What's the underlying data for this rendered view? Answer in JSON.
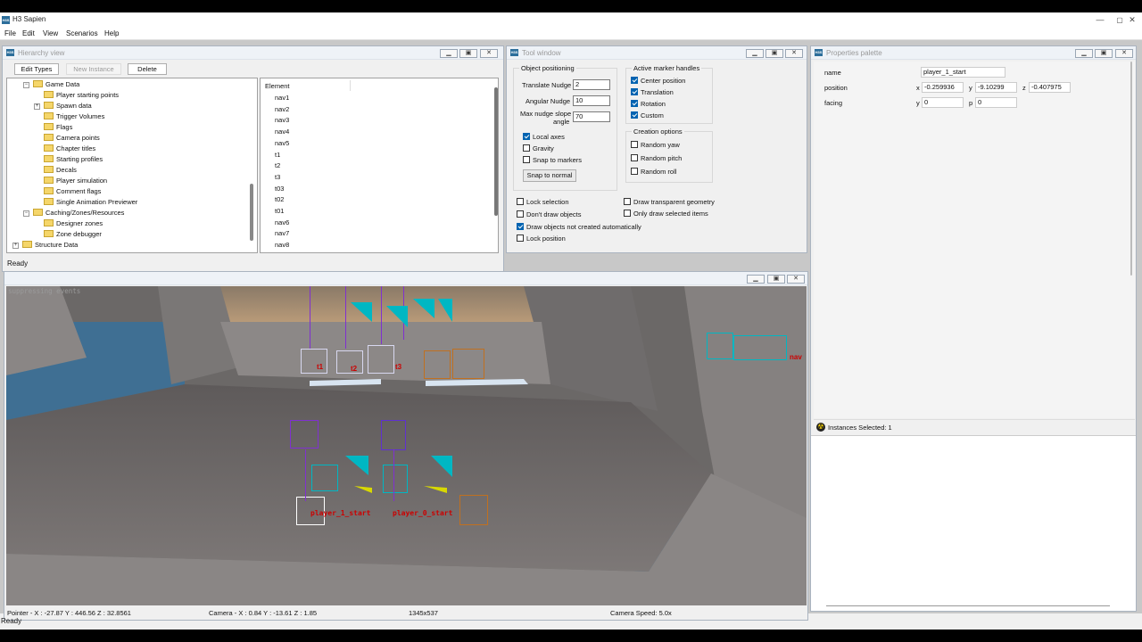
{
  "app": {
    "title": "H3 Sapien",
    "icon_text": "H3S",
    "window_controls": [
      "—",
      "▢",
      "✕"
    ],
    "menu": [
      "File",
      "Edit",
      "View",
      "Scenarios",
      "Help"
    ],
    "status": "Ready"
  },
  "hierarchy": {
    "title": "Hierarchy view",
    "toolbar": {
      "edit_types": "Edit Types",
      "new_instance": "New Instance",
      "delete": "Delete"
    },
    "tree": [
      {
        "label": "Game Data",
        "expander": "−"
      },
      {
        "label": "Player starting points"
      },
      {
        "label": "Spawn data",
        "expander": "+"
      },
      {
        "label": "Trigger Volumes"
      },
      {
        "label": "Flags"
      },
      {
        "label": "Camera points"
      },
      {
        "label": "Chapter titles"
      },
      {
        "label": "Starting profiles"
      },
      {
        "label": "Decals"
      },
      {
        "label": "Player simulation"
      },
      {
        "label": "Comment flags"
      },
      {
        "label": "Single Animation Previewer"
      },
      {
        "label": "Caching/Zones/Resources",
        "expander": "−"
      },
      {
        "label": "Designer zones"
      },
      {
        "label": "Zone debugger"
      },
      {
        "label": "Structure Data",
        "expander": "+"
      }
    ],
    "list_header": "Element",
    "list": [
      "nav1",
      "nav2",
      "nav3",
      "nav4",
      "nav5",
      "t1",
      "t2",
      "t3",
      "t03",
      "t02",
      "t01",
      "nav6",
      "nav7",
      "nav8"
    ],
    "status": "Ready"
  },
  "tool": {
    "title": "Tool window",
    "object_positioning": {
      "label": "Object positioning",
      "translate_nudge_label": "Translate Nudge",
      "translate_nudge": "2",
      "angular_nudge_label": "Angular Nudge",
      "angular_nudge": "10",
      "max_nudge_label_1": "Max nudge slope",
      "max_nudge_label_2": "angle",
      "max_nudge": "70",
      "local_axes": "Local axes",
      "gravity": "Gravity",
      "snap_to_markers": "Snap to markers",
      "snap_to_normal": "Snap to normal"
    },
    "marker_handles": {
      "label": "Active marker handles",
      "center_position": "Center position",
      "translation": "Translation",
      "rotation": "Rotation",
      "custom": "Custom"
    },
    "creation": {
      "label": "Creation options",
      "random_yaw": "Random yaw",
      "random_pitch": "Random pitch",
      "random_roll": "Random roll"
    },
    "lock_selection": "Lock selection",
    "dont_draw": "Don't draw objects",
    "draw_not_created": "Draw objects not created automatically",
    "lock_position": "Lock position",
    "draw_transparent": "Draw transparent geometry",
    "only_draw_selected": "Only draw selected items"
  },
  "properties": {
    "title": "Properties palette",
    "name_label": "name",
    "name_value": "player_1_start",
    "position_label": "position",
    "x_label": "x",
    "x_value": "-0.259936",
    "y_label": "y",
    "y_value": "-9.10299",
    "z_label": "z",
    "z_value": "-0.407975",
    "facing_label": "facing",
    "facing_y_label": "y",
    "facing_y": "0",
    "facing_p_label": "p",
    "facing_p": "0",
    "instances_selected": "Instances Selected: 1"
  },
  "viewport": {
    "overlay_text": "suppressing events",
    "labels": {
      "t1": "t1",
      "t2": "t2",
      "t3": "t3",
      "nav": "nav",
      "p1": "player_1_start",
      "p0": "player_0_start"
    },
    "status": {
      "pointer": "Pointer - X : -27.87  Y : 446.56  Z : 32.8561",
      "camera": "Camera - X : 0.84  Y : -13.61  Z : 1.85",
      "size": "1345x537",
      "speed": "Camera Speed: 5.0x"
    }
  },
  "colors": {
    "accent": "#0063b1",
    "folder": "#f5d66a",
    "marker_cyan": "#00b7c3",
    "marker_red": "#cc0000"
  }
}
